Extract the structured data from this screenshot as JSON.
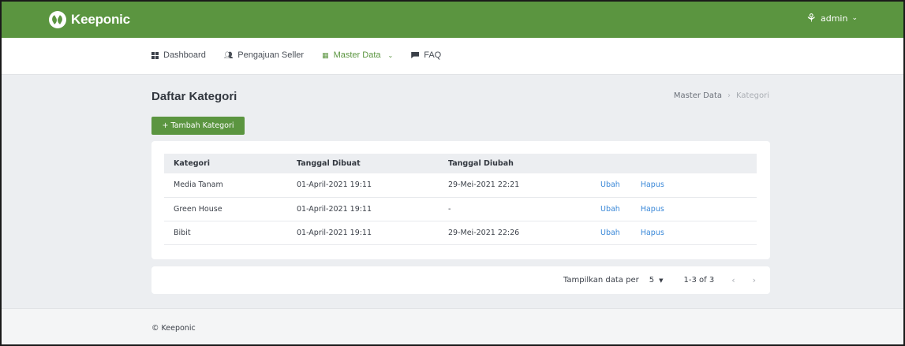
{
  "brand": {
    "name": "Keeponic"
  },
  "user": {
    "name": "admin"
  },
  "nav": {
    "items": [
      {
        "label": "Dashboard",
        "icon": "dashboard-icon"
      },
      {
        "label": "Pengajuan Seller",
        "icon": "users-icon"
      },
      {
        "label": "Master Data",
        "icon": "database-icon",
        "active": true
      },
      {
        "label": "FAQ",
        "icon": "flag-icon"
      }
    ]
  },
  "page": {
    "title": "Daftar Kategori",
    "breadcrumb": [
      "Master Data",
      "Kategori"
    ],
    "add_button": "+ Tambah Kategori"
  },
  "table": {
    "columns": [
      "Kategori",
      "Tanggal Dibuat",
      "Tanggal Diubah"
    ],
    "rows": [
      {
        "kategori": "Media Tanam",
        "dibuat": "01-April-2021 19:11",
        "diubah": "29-Mei-2021 22:21",
        "edit": "Ubah",
        "delete": "Hapus"
      },
      {
        "kategori": "Green House",
        "dibuat": "01-April-2021 19:11",
        "diubah": "-",
        "edit": "Ubah",
        "delete": "Hapus"
      },
      {
        "kategori": "Bibit",
        "dibuat": "01-April-2021 19:11",
        "diubah": "29-Mei-2021 22:26",
        "edit": "Ubah",
        "delete": "Hapus"
      }
    ]
  },
  "pagination": {
    "per_page_label": "Tampilkan data per",
    "per_page_value": "5",
    "range": "1-3 of 3"
  },
  "footer": {
    "text": "© Keeponic"
  },
  "colors": {
    "brand_green": "#5b9540",
    "link_blue": "#3a88d8"
  }
}
